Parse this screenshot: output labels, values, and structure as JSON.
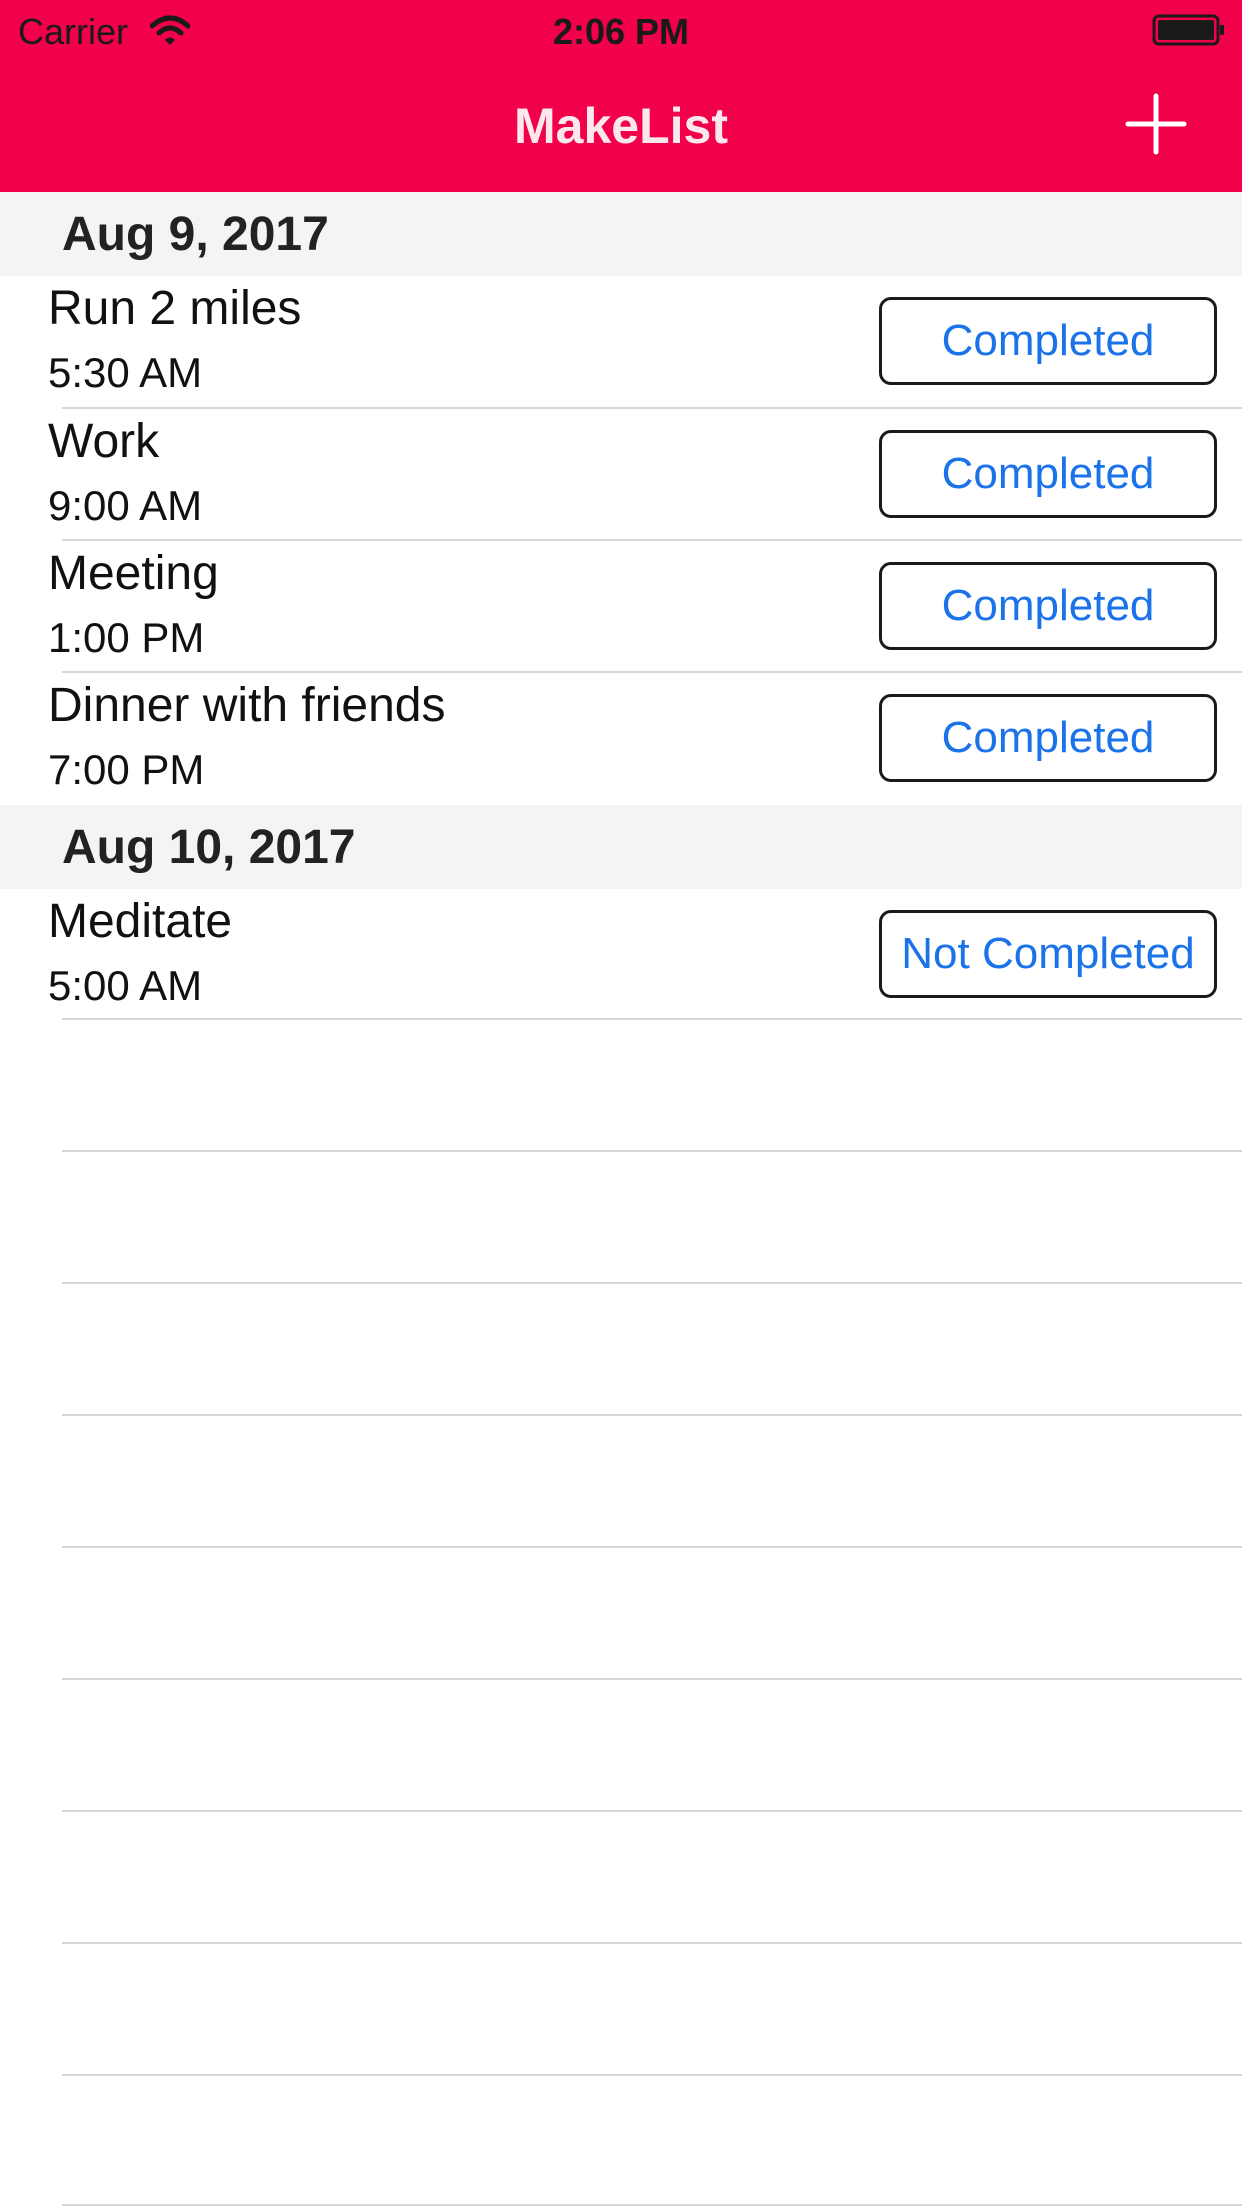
{
  "status_bar": {
    "carrier": "Carrier",
    "time": "2:06 PM",
    "wifi_icon": "wifi-icon",
    "battery_icon": "battery-icon"
  },
  "nav_bar": {
    "title": "MakeList",
    "add_icon": "plus-icon",
    "background_color": "#f1014a"
  },
  "sections": [
    {
      "title": "Aug 9, 2017",
      "items": [
        {
          "name": "Run 2 miles",
          "time": "5:30 AM",
          "status": "Completed"
        },
        {
          "name": "Work",
          "time": "9:00 AM",
          "status": "Completed"
        },
        {
          "name": "Meeting",
          "time": "1:00 PM",
          "status": "Completed"
        },
        {
          "name": "Dinner with friends",
          "time": "7:00 PM",
          "status": "Completed"
        }
      ]
    },
    {
      "title": "Aug 10, 2017",
      "items": [
        {
          "name": "Meditate",
          "time": "5:00 AM",
          "status": "Not Completed"
        }
      ]
    }
  ],
  "colors": {
    "status_button_text": "#1a73e8",
    "section_header_bg": "#f4f4f4"
  }
}
